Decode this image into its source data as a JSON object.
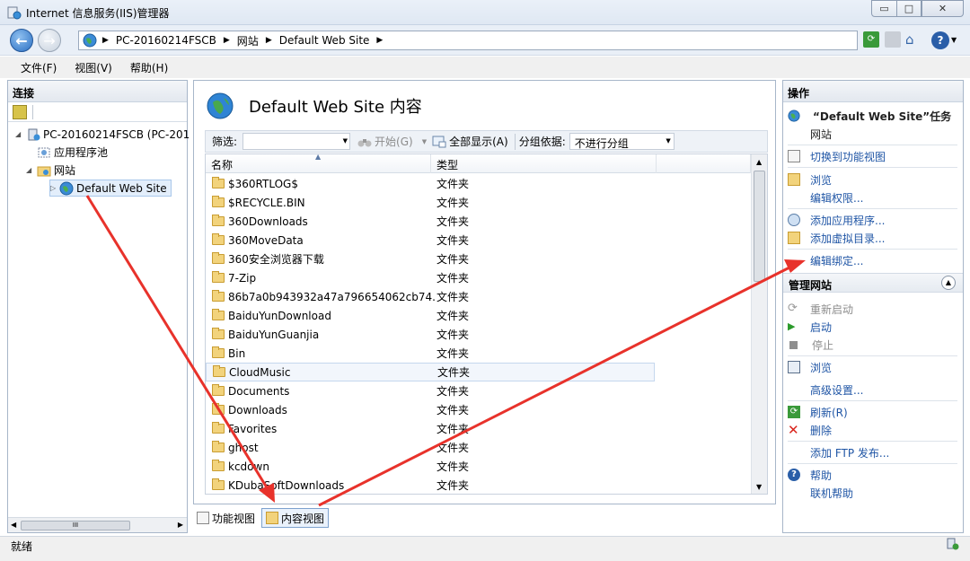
{
  "window": {
    "title": "Internet 信息服务(IIS)管理器",
    "min_glyph": "▭",
    "max_glyph": "□",
    "close_glyph": "✕"
  },
  "address": {
    "crumbs": [
      "PC-20160214FSCB",
      "网站",
      "Default Web Site"
    ],
    "help_glyph": "?"
  },
  "menu": [
    "文件(F)",
    "视图(V)",
    "帮助(H)"
  ],
  "connections": {
    "header": "连接",
    "tree": [
      {
        "label": "PC-20160214FSCB (PC-201"
      },
      {
        "label": "应用程序池"
      },
      {
        "label": "网站"
      },
      {
        "label": "Default Web Site"
      }
    ],
    "hscroll_glyph": "III"
  },
  "content": {
    "title": "Default Web Site 内容",
    "filter_label": "筛选:",
    "start_label": "开始(G)",
    "show_all_label": "全部显示(A)",
    "group_label": "分组依据:",
    "group_value": "不进行分组",
    "columns": [
      "名称",
      "类型"
    ],
    "rows": [
      {
        "name": "$360RTLOG$",
        "type": "文件夹"
      },
      {
        "name": "$RECYCLE.BIN",
        "type": "文件夹"
      },
      {
        "name": "360Downloads",
        "type": "文件夹"
      },
      {
        "name": "360MoveData",
        "type": "文件夹"
      },
      {
        "name": "360安全浏览器下载",
        "type": "文件夹"
      },
      {
        "name": "7-Zip",
        "type": "文件夹"
      },
      {
        "name": "86b7a0b943932a47a796654062cb74...",
        "type": "文件夹"
      },
      {
        "name": "BaiduYunDownload",
        "type": "文件夹"
      },
      {
        "name": "BaiduYunGuanjia",
        "type": "文件夹"
      },
      {
        "name": "Bin",
        "type": "文件夹"
      },
      {
        "name": "CloudMusic",
        "type": "文件夹"
      },
      {
        "name": "Documents",
        "type": "文件夹"
      },
      {
        "name": "Downloads",
        "type": "文件夹"
      },
      {
        "name": "Favorites",
        "type": "文件夹"
      },
      {
        "name": "ghost",
        "type": "文件夹"
      },
      {
        "name": "kcdown",
        "type": "文件夹"
      },
      {
        "name": "KDubaSoftDownloads",
        "type": "文件夹"
      }
    ],
    "tabs": [
      "功能视图",
      "内容视图"
    ]
  },
  "actions": {
    "header": "操作",
    "site_task": "“Default Web Site”任务",
    "site_sub": "网站",
    "switch_feature": "切换到功能视图",
    "browse": "浏览",
    "edit_perms": "编辑权限...",
    "add_app": "添加应用程序...",
    "add_vdir": "添加虚拟目录...",
    "edit_bindings": "编辑绑定...",
    "manage_header": "管理网站",
    "restart": "重新启动",
    "start": "启动",
    "stop": "停止",
    "browse2": "浏览",
    "advanced": "高级设置...",
    "refresh": "刷新(R)",
    "delete": "删除",
    "add_ftp": "添加 FTP 发布...",
    "help": "帮助",
    "online_help": "联机帮助"
  },
  "status": {
    "text": "就绪"
  },
  "colors": {
    "annotation_arrow": "#e8322b",
    "link": "#1f55a5"
  }
}
